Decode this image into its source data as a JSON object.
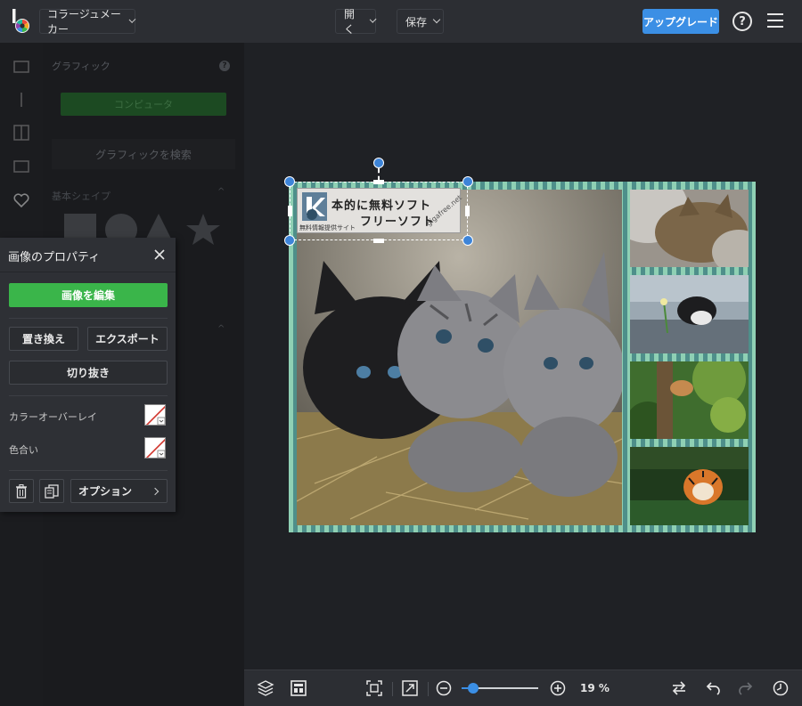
{
  "header": {
    "app_menu": "コラージュメーカー",
    "open_menu": "開く",
    "save_menu": "保存",
    "upgrade_label": "アップグレード",
    "help_glyph": "?"
  },
  "graphics_panel": {
    "title": "グラフィック",
    "computer_button": "コンピュータ",
    "search_button": "グラフィックを検索",
    "basic_shapes_label": "基本シェイプ"
  },
  "image_properties": {
    "title": "画像のプロパティ",
    "edit_button": "画像を編集",
    "replace_button": "置き換え",
    "export_button": "エクスポート",
    "crop_button": "切り抜き",
    "color_overlay_label": "カラーオーバーレイ",
    "tint_label": "色合い",
    "options_button": "オプション"
  },
  "canvas": {
    "watermark": {
      "line1": "本的に無料ソフト",
      "line2": "フリーソフト",
      "line3": "無料情報提供サイト",
      "domain": "gigafree.net"
    }
  },
  "bottom_toolbar": {
    "zoom_value": "19 %",
    "zoom_level": 0.19
  },
  "colors": {
    "accent": "#3b8fe5",
    "edit_green": "#3ab54a",
    "collage_border_a": "#8fd0b4",
    "collage_border_b": "#4e8f8a"
  }
}
